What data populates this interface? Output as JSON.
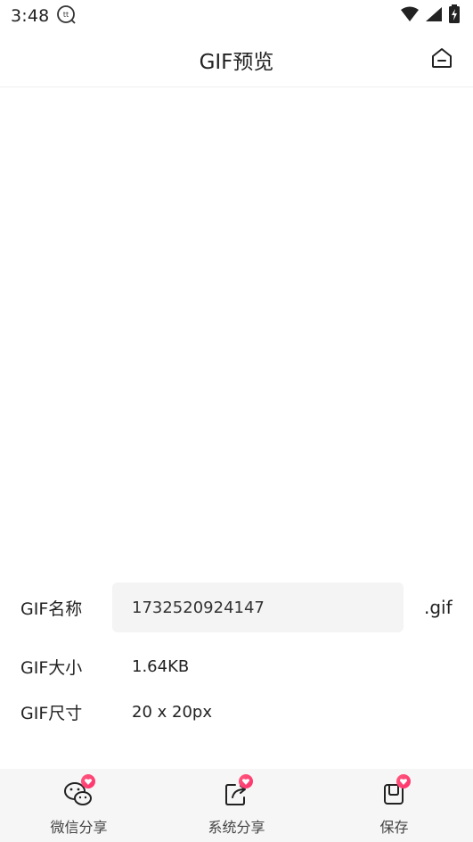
{
  "status_bar": {
    "time": "3:48",
    "icons": [
      "notification-icon",
      "wifi-icon",
      "signal-icon",
      "battery-icon"
    ]
  },
  "app_bar": {
    "title": "GIF预览",
    "home_icon": "home-icon"
  },
  "info": {
    "name_label": "GIF名称",
    "name_value": "1732520924147",
    "extension": ".gif",
    "size_label": "GIF大小",
    "size_value": "1.64KB",
    "dimension_label": "GIF尺寸",
    "dimension_value": "20 x 20px"
  },
  "bottom_bar": {
    "items": [
      {
        "label": "微信分享",
        "icon": "wechat-icon"
      },
      {
        "label": "系统分享",
        "icon": "share-icon"
      },
      {
        "label": "保存",
        "icon": "save-icon"
      }
    ]
  },
  "colors": {
    "badge": "#ff3c6e",
    "field_background": "#f4f4f4",
    "bottom_bar_background": "#f6f6f6"
  }
}
